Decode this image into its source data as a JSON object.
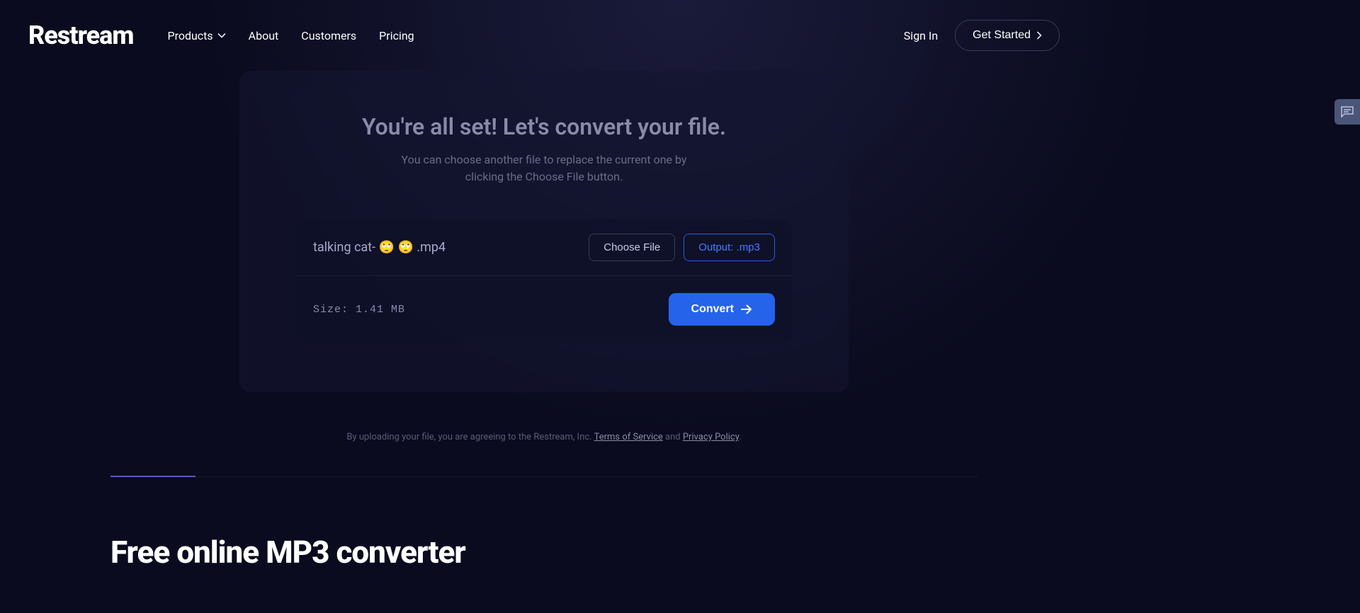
{
  "header": {
    "logo": "Restream",
    "nav": {
      "products": "Products",
      "about": "About",
      "customers": "Customers",
      "pricing": "Pricing"
    },
    "sign_in": "Sign In",
    "get_started": "Get Started"
  },
  "converter": {
    "heading": "You're all set! Let's convert your file.",
    "subheading": "You can choose another file to replace the current one by clicking the Choose File button.",
    "filename": "talking cat- 🙄 🙄 .mp4",
    "choose_file": "Choose File",
    "output_label": "Output: .mp3",
    "size_label": "Size: 1.41 MB",
    "convert": "Convert"
  },
  "legal": {
    "prefix": "By uploading your file, you are agreeing to the Restream, Inc. ",
    "terms": "Terms of Service",
    "and": " and ",
    "privacy": "Privacy Policy",
    "suffix": "."
  },
  "page_title": "Free online MP3 converter"
}
